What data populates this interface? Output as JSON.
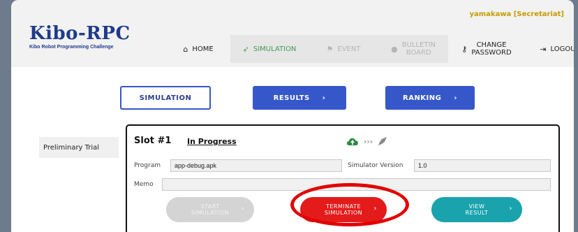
{
  "user": {
    "label": "yamakawa [Secretariat]"
  },
  "logo": {
    "title": "Kibo-RPC",
    "subtitle": "Kibo Robot Programming Challenge"
  },
  "nav": {
    "home": "HOME",
    "simulation": "SIMULATION",
    "event": "EVENT",
    "bulletin_line1": "BULLETIN",
    "bulletin_line2": "BOARD",
    "change_line1": "CHANGE",
    "change_line2": "PASSWORD",
    "logout": "LOGOUT"
  },
  "tabs": {
    "simulation": "SIMULATION",
    "results": "RESULTS",
    "ranking": "RANKING"
  },
  "sidebar": {
    "items": [
      {
        "label": "Preliminary Trial"
      }
    ]
  },
  "slot": {
    "title": "Slot #1",
    "status": "In Progress",
    "program_label": "Program",
    "program_value": "app-debug.apk",
    "sim_version_label": "Simulator Version",
    "sim_version_value": "1.0",
    "memo_label": "Memo",
    "memo_value": ""
  },
  "buttons": {
    "start_line1": "START",
    "start_line2": "SIMULATION",
    "terminate_line1": "TERMINATE",
    "terminate_line2": "SIMULATION",
    "view_line1": "VIEW",
    "view_line2": "RESULT"
  },
  "colors": {
    "brand": "#1f3b8a",
    "accent_blue": "#3657c9",
    "terminate_red": "#e41b1b",
    "view_teal": "#1aa3ad",
    "highlight": "#e30000",
    "user": "#c79a00",
    "nav_active": "#3f9a53"
  },
  "icons": [
    "home-icon",
    "rocket-icon",
    "flag-icon",
    "chat-icon",
    "key-icon",
    "logout-icon",
    "cloud-upload-icon",
    "chevrons-icon"
  ]
}
